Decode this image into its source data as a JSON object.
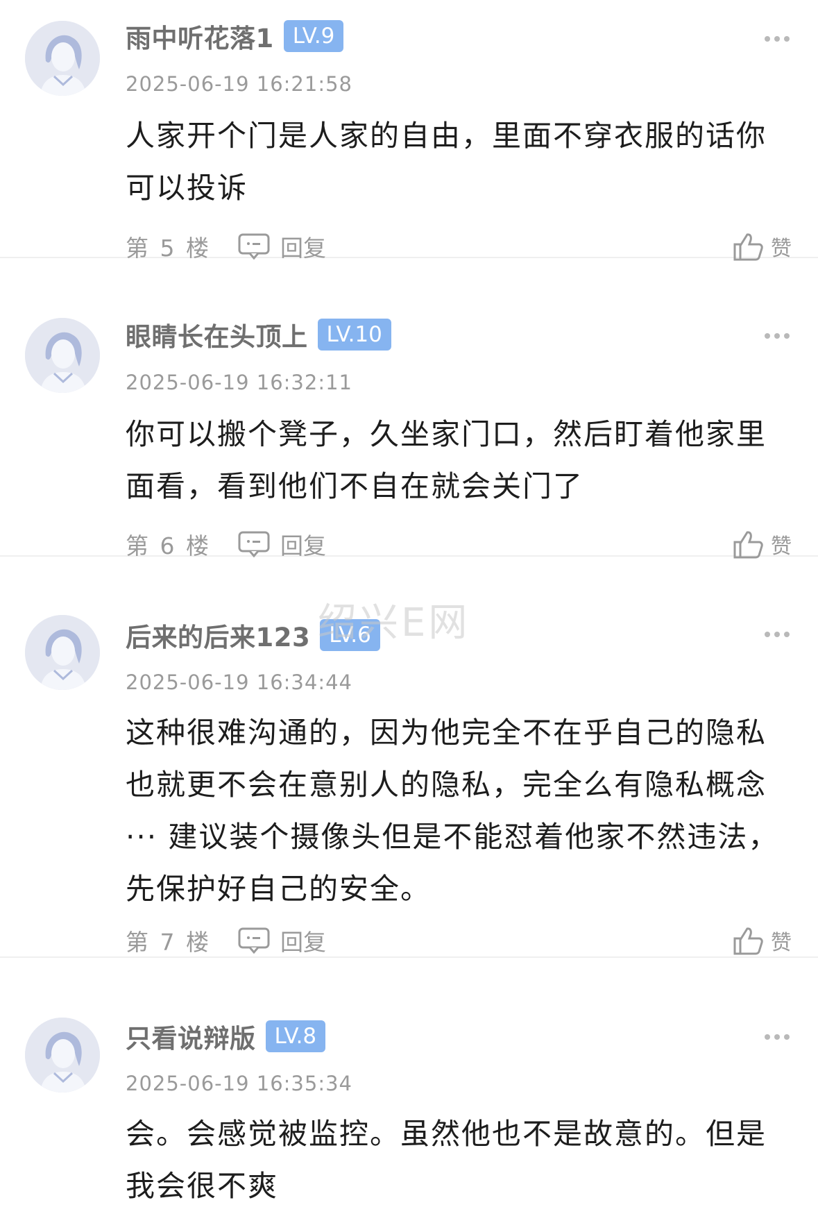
{
  "comments": [
    {
      "username": "雨中听花落1",
      "level": "LV.9",
      "timestamp": "2025-06-19 16:21:58",
      "text": "人家开个门是人家的自由，里面不穿衣服的话你可以投诉",
      "floor": "第 5 楼",
      "reply_label": "回复",
      "like_label": "赞"
    },
    {
      "username": "眼睛长在头顶上",
      "level": "LV.10",
      "timestamp": "2025-06-19 16:32:11",
      "text": "你可以搬个凳子，久坐家门口，然后盯着他家里面看，看到他们不自在就会关门了",
      "floor": "第 6 楼",
      "reply_label": "回复",
      "like_label": "赞"
    },
    {
      "username": "后来的后来123",
      "level": "LV.6",
      "timestamp": "2025-06-19 16:34:44",
      "text": "这种很难沟通的，因为他完全不在乎自己的隐私也就更不会在意别人的隐私，完全么有隐私概念··· 建议装个摄像头但是不能怼着他家不然违法，先保护好自己的安全。",
      "floor": "第 7 楼",
      "reply_label": "回复",
      "like_label": "赞"
    },
    {
      "username": "只看说辩版",
      "level": "LV.8",
      "timestamp": "2025-06-19 16:35:34",
      "text": "会。会感觉被监控。虽然他也不是故意的。但是我会很不爽",
      "floor": "",
      "reply_label": "",
      "like_label": ""
    }
  ],
  "watermark": "绍兴E网",
  "icons": {
    "avatar": "default-avatar-icon",
    "more": "more-dots-icon",
    "reply": "reply-bubble-icon",
    "like": "thumbs-up-icon"
  },
  "colors": {
    "level_badge": "#86b4f0",
    "username": "#6f6f6f",
    "meta": "#9a9a9a",
    "avatar_bg": "#e4e7f1"
  }
}
